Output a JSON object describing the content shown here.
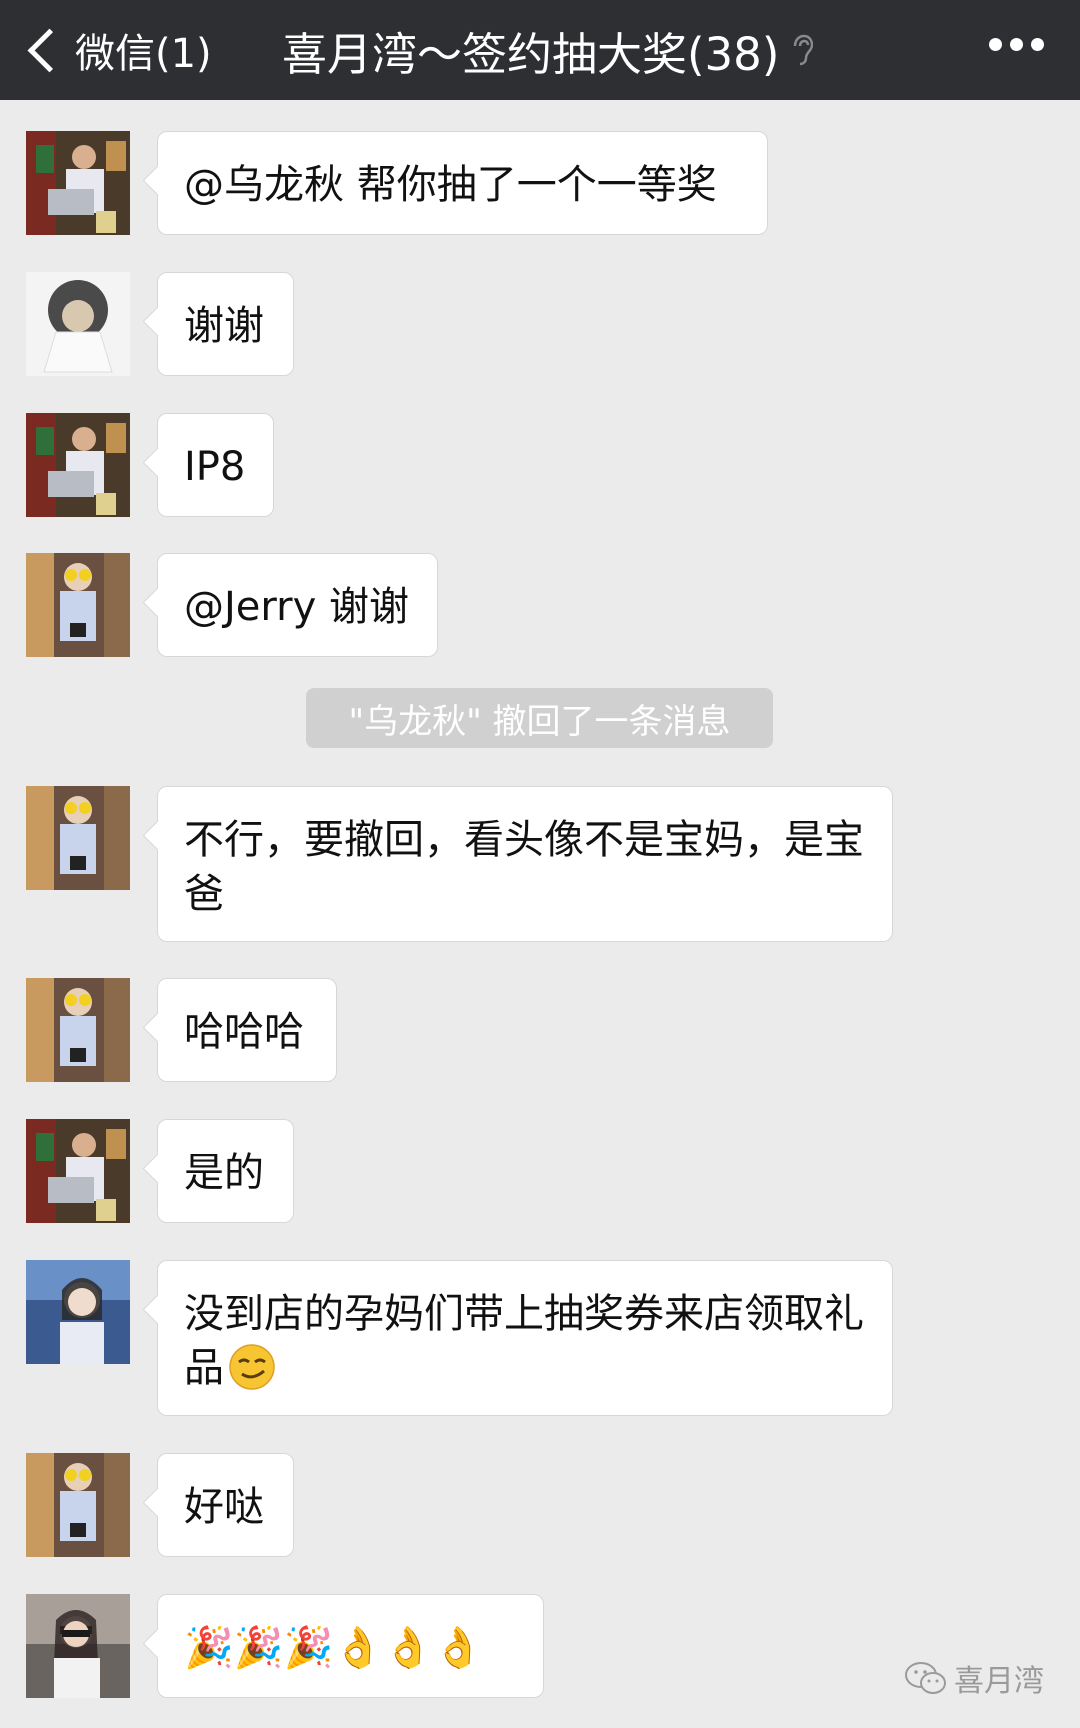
{
  "header": {
    "back_label": "微信(1)",
    "title": "喜月湾～签约抽大奖(38)"
  },
  "messages": [
    {
      "text": "@乌龙秋 帮你抽了一个一等奖",
      "avatar": "man-with-laptop"
    },
    {
      "text": "谢谢",
      "avatar": "plush-doll"
    },
    {
      "text": "IP8",
      "avatar": "man-with-laptop"
    },
    {
      "text": "@Jerry 谢谢",
      "avatar": "woman-with-sunglasses"
    },
    {
      "text": "不行，要撤回，看头像不是宝妈，是宝爸",
      "avatar": "woman-with-sunglasses"
    },
    {
      "text": "哈哈哈",
      "avatar": "woman-with-sunglasses"
    },
    {
      "text": "是的",
      "avatar": "man-with-laptop"
    },
    {
      "text": "没到店的孕妈们带上抽奖券来店领取礼品",
      "avatar": "woman-portrait-blue",
      "emoji": "smirk-emoji"
    },
    {
      "text": "好哒",
      "avatar": "woman-with-sunglasses"
    },
    {
      "text": "🎉🎉🎉👌👌👌",
      "avatar": "woman-sunglasses-street"
    }
  ],
  "system_notice": "\"乌龙秋\" 撤回了一条消息",
  "watermark": "喜月湾",
  "colors": {
    "navbar": "#2e2f33",
    "background": "#ebebeb",
    "bubble": "#ffffff",
    "notice": "#d0d0d0"
  }
}
